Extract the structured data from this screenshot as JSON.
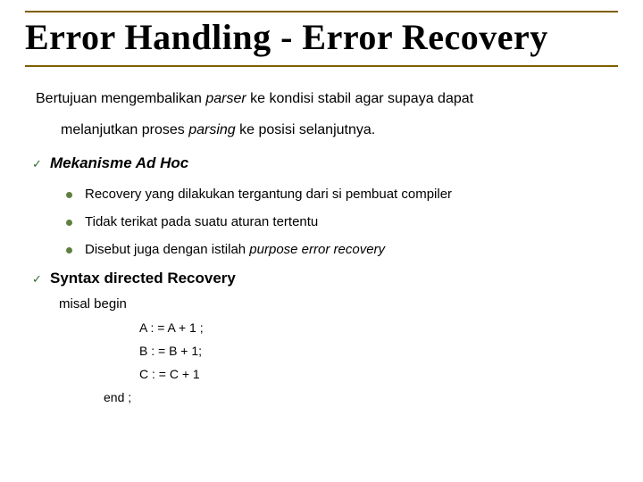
{
  "title": "Error Handling - Error Recovery",
  "intro": {
    "line1_pre": "Bertujuan mengembalikan ",
    "line1_italic": "parser",
    "line1_post": " ke kondisi stabil agar supaya dapat",
    "line2_pre": "melanjutkan proses ",
    "line2_italic": "parsing",
    "line2_post": " ke posisi selanjutnya."
  },
  "items": {
    "adhoc": {
      "label": "Mekanisme Ad Hoc",
      "bullets": {
        "b1": "Recovery yang dilakukan tergantung dari si pembuat compiler",
        "b2": "Tidak terikat pada suatu aturan tertentu",
        "b3_pre": "Disebut juga dengan istilah ",
        "b3_italic": "purpose error recovery"
      }
    },
    "syntax": {
      "label": "Syntax directed Recovery",
      "sub": "misal  begin",
      "code": {
        "l1": "A : = A + 1  ;",
        "l2": "B : = B + 1;",
        "l3": "C : = C + 1"
      },
      "end": "end ;"
    }
  }
}
